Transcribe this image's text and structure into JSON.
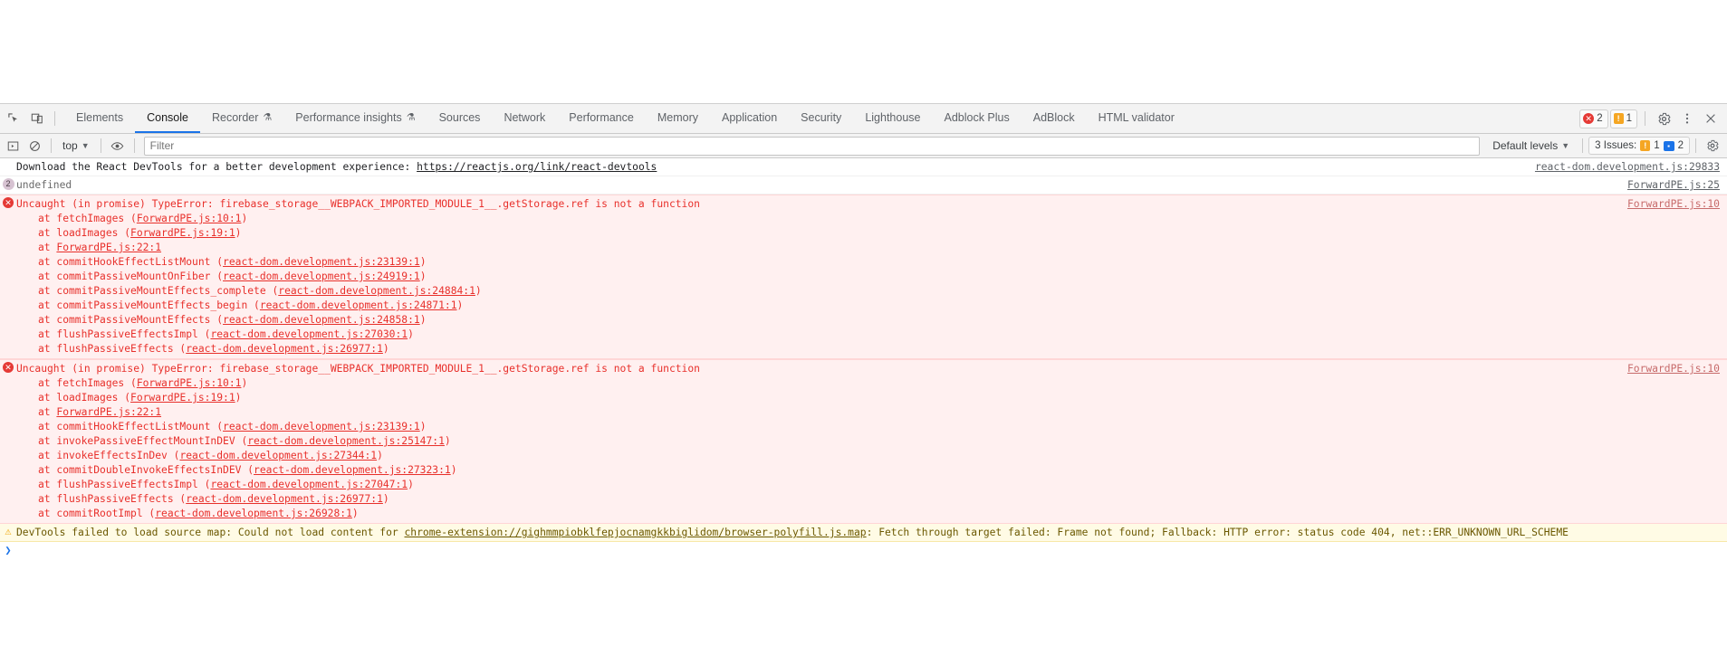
{
  "devtools": {
    "tabstrip": {
      "inspect_icon": "inspect-element-icon",
      "device_toolbar_icon": "device-toolbar-icon",
      "tabs": [
        {
          "label": "Elements",
          "selected": false,
          "experiment": false
        },
        {
          "label": "Console",
          "selected": true,
          "experiment": false
        },
        {
          "label": "Recorder",
          "selected": false,
          "experiment": true
        },
        {
          "label": "Performance insights",
          "selected": false,
          "experiment": true
        },
        {
          "label": "Sources",
          "selected": false,
          "experiment": false
        },
        {
          "label": "Network",
          "selected": false,
          "experiment": false
        },
        {
          "label": "Performance",
          "selected": false,
          "experiment": false
        },
        {
          "label": "Memory",
          "selected": false,
          "experiment": false
        },
        {
          "label": "Application",
          "selected": false,
          "experiment": false
        },
        {
          "label": "Security",
          "selected": false,
          "experiment": false
        },
        {
          "label": "Lighthouse",
          "selected": false,
          "experiment": false
        },
        {
          "label": "Adblock Plus",
          "selected": false,
          "experiment": false
        },
        {
          "label": "AdBlock",
          "selected": false,
          "experiment": false
        },
        {
          "label": "HTML validator",
          "selected": false,
          "experiment": false
        }
      ],
      "error_count": "2",
      "warning_count": "1",
      "settings_icon": "gear-icon",
      "more_icon": "kebab-menu-icon",
      "close_icon": "close-icon"
    },
    "filterbar": {
      "sidebar_toggle_icon": "show-console-sidebar-icon",
      "clear_icon": "clear-console-icon",
      "context_label": "top",
      "context_caret": "▼",
      "eye_icon": "live-expression-icon",
      "filter_placeholder": "Filter",
      "filter_value": "",
      "levels_label": "Default levels",
      "levels_caret": "▼",
      "issues_label": "3 Issues:",
      "issues_warning_count": "1",
      "issues_info_count": "2",
      "settings_icon": "console-settings-icon"
    },
    "console": {
      "messages": [
        {
          "type": "info",
          "text": "Download the React DevTools for a better development experience: ",
          "link": "https://reactjs.org/link/react-devtools",
          "source": "react-dom.development.js:29833"
        },
        {
          "type": "undefined",
          "badge": "2",
          "text": "undefined",
          "source": "ForwardPE.js:25"
        },
        {
          "type": "error",
          "header": "Uncaught (in promise) TypeError: firebase_storage__WEBPACK_IMPORTED_MODULE_1__.getStorage.ref is not a function",
          "source": "ForwardPE.js:10",
          "stack": [
            {
              "fn": "at fetchImages (",
              "loc": "ForwardPE.js:10:1",
              "tail": ")"
            },
            {
              "fn": "at loadImages (",
              "loc": "ForwardPE.js:19:1",
              "tail": ")"
            },
            {
              "fn": "at ",
              "loc": "ForwardPE.js:22:1",
              "tail": ""
            },
            {
              "fn": "at commitHookEffectListMount (",
              "loc": "react-dom.development.js:23139:1",
              "tail": ")"
            },
            {
              "fn": "at commitPassiveMountOnFiber (",
              "loc": "react-dom.development.js:24919:1",
              "tail": ")"
            },
            {
              "fn": "at commitPassiveMountEffects_complete (",
              "loc": "react-dom.development.js:24884:1",
              "tail": ")"
            },
            {
              "fn": "at commitPassiveMountEffects_begin (",
              "loc": "react-dom.development.js:24871:1",
              "tail": ")"
            },
            {
              "fn": "at commitPassiveMountEffects (",
              "loc": "react-dom.development.js:24858:1",
              "tail": ")"
            },
            {
              "fn": "at flushPassiveEffectsImpl (",
              "loc": "react-dom.development.js:27030:1",
              "tail": ")"
            },
            {
              "fn": "at flushPassiveEffects (",
              "loc": "react-dom.development.js:26977:1",
              "tail": ")"
            }
          ]
        },
        {
          "type": "error",
          "header": "Uncaught (in promise) TypeError: firebase_storage__WEBPACK_IMPORTED_MODULE_1__.getStorage.ref is not a function",
          "source": "ForwardPE.js:10",
          "stack": [
            {
              "fn": "at fetchImages (",
              "loc": "ForwardPE.js:10:1",
              "tail": ")"
            },
            {
              "fn": "at loadImages (",
              "loc": "ForwardPE.js:19:1",
              "tail": ")"
            },
            {
              "fn": "at ",
              "loc": "ForwardPE.js:22:1",
              "tail": ""
            },
            {
              "fn": "at commitHookEffectListMount (",
              "loc": "react-dom.development.js:23139:1",
              "tail": ")"
            },
            {
              "fn": "at invokePassiveEffectMountInDEV (",
              "loc": "react-dom.development.js:25147:1",
              "tail": ")"
            },
            {
              "fn": "at invokeEffectsInDev (",
              "loc": "react-dom.development.js:27344:1",
              "tail": ")"
            },
            {
              "fn": "at commitDoubleInvokeEffectsInDEV (",
              "loc": "react-dom.development.js:27323:1",
              "tail": ")"
            },
            {
              "fn": "at flushPassiveEffectsImpl (",
              "loc": "react-dom.development.js:27047:1",
              "tail": ")"
            },
            {
              "fn": "at flushPassiveEffects (",
              "loc": "react-dom.development.js:26977:1",
              "tail": ")"
            },
            {
              "fn": "at commitRootImpl (",
              "loc": "react-dom.development.js:26928:1",
              "tail": ")"
            }
          ]
        },
        {
          "type": "warning",
          "prefix": "DevTools failed to load source map: Could not load content for ",
          "link": "chrome-extension://gighmmpiobklfepjocnamgkkbiglidom/browser-polyfill.js.map",
          "suffix": ": Fetch through target failed: Frame not found; Fallback: HTTP error: status code 404, net::ERR_UNKNOWN_URL_SCHEME"
        }
      ],
      "prompt_caret": "❯"
    }
  },
  "colors": {
    "accent": "#1a73e8",
    "error_text": "#e8302b",
    "error_bg": "#fff0f0",
    "warning_bg": "#fffbe5",
    "warning_text": "#6b5800",
    "toolbar_bg": "#f3f3f3"
  }
}
